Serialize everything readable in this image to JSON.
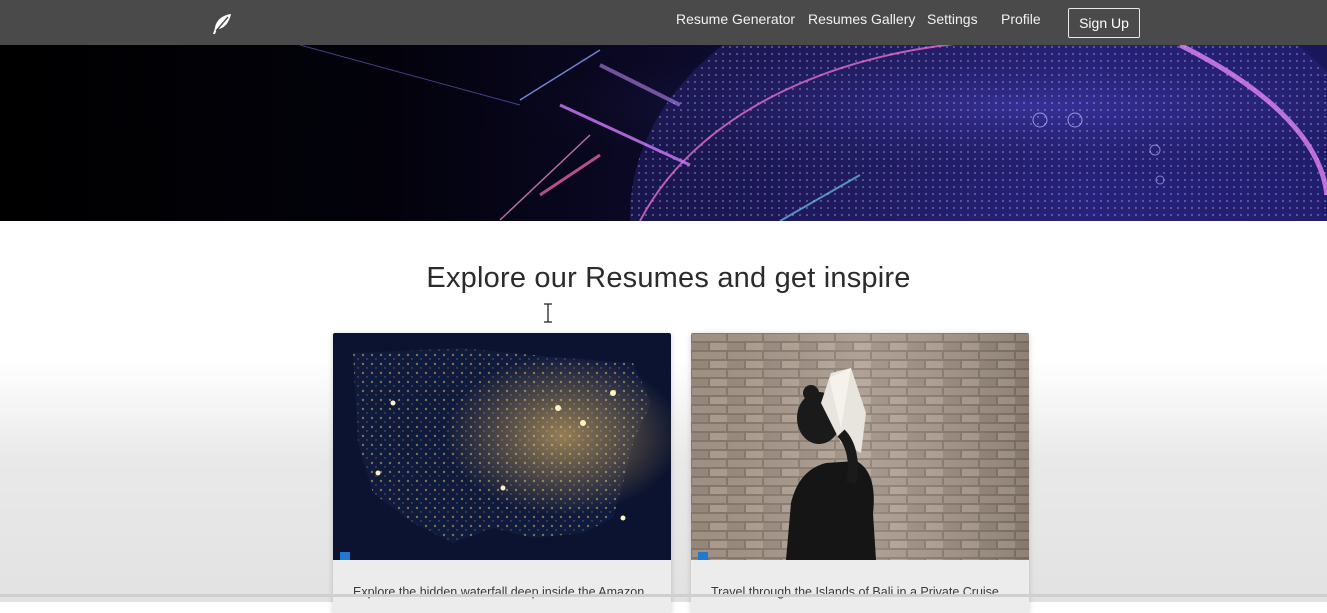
{
  "nav": {
    "logo_icon": "feather-icon",
    "links": [
      "Resume Generator",
      "Resumes Gallery",
      "Settings",
      "Profile"
    ],
    "signup_label": "Sign Up"
  },
  "hero": {
    "image": "digital-globe-network-banner"
  },
  "section": {
    "title": "Explore our Resumes and get inspire"
  },
  "cards": [
    {
      "image": "usa-night-lights-map",
      "caption": "Explore the hidden waterfall deep inside the Amazon"
    },
    {
      "image": "woman-with-book-on-face-brick-wall",
      "caption": "Travel through the Islands of Bali in a Private Cruise"
    }
  ],
  "colors": {
    "navbar": "#4a4a4a",
    "accent_marker": "#1f78d1",
    "title_text": "#2b2b2b"
  }
}
